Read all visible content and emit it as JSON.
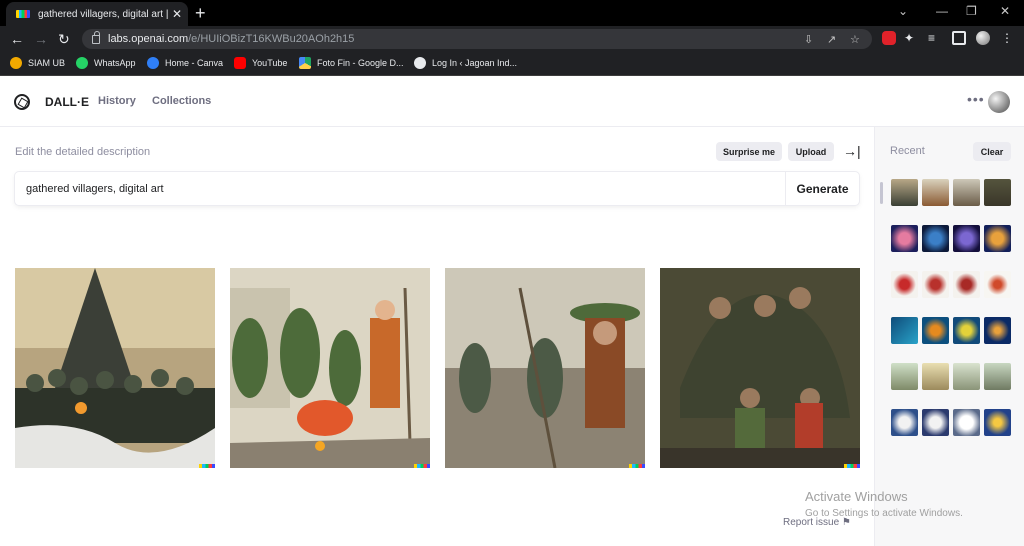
{
  "browser": {
    "tab_title": "gathered villagers, digital art | DALL·E",
    "tab_close": "✕",
    "new_tab": "+",
    "url_host": "labs.openai.com",
    "url_path": "/e/HUIiOBizT16KWBu20AOh2h15",
    "window_controls": [
      "⌄",
      "—",
      "❐",
      "✕"
    ]
  },
  "bookmarks": [
    {
      "label": "SIAM UB",
      "color": "#f2a900"
    },
    {
      "label": "WhatsApp",
      "color": "#25d366"
    },
    {
      "label": "Home - Canva",
      "color": "#2f7ff7"
    },
    {
      "label": "YouTube",
      "color": "#ff0000"
    },
    {
      "label": "Foto Fin - Google D...",
      "color": "#1fa463"
    },
    {
      "label": "Log In ‹ Jagoan Ind...",
      "color": "#e8eaed"
    }
  ],
  "header": {
    "brand": "DALL·E",
    "nav": [
      "History",
      "Collections"
    ],
    "more": "•••"
  },
  "editor": {
    "label": "Edit the detailed description",
    "surprise": "Surprise me",
    "upload": "Upload",
    "collapse": "→|",
    "prompt_value": "gathered villagers, digital art",
    "generate": "Generate"
  },
  "sidebar": {
    "title": "Recent",
    "clear": "Clear"
  },
  "overlay": {
    "activate_title": "Activate Windows",
    "activate_sub": "Go to Settings to activate Windows.",
    "report": "Report issue ⚑"
  },
  "icons": {
    "back": "back-arrow-icon",
    "forward": "forward-arrow-icon",
    "reload": "reload-icon",
    "brand": "openai-logo-icon"
  },
  "colors": {
    "chrome_dark": "#202124",
    "accent_text": "#202123",
    "muted_text": "#6e6e80"
  }
}
